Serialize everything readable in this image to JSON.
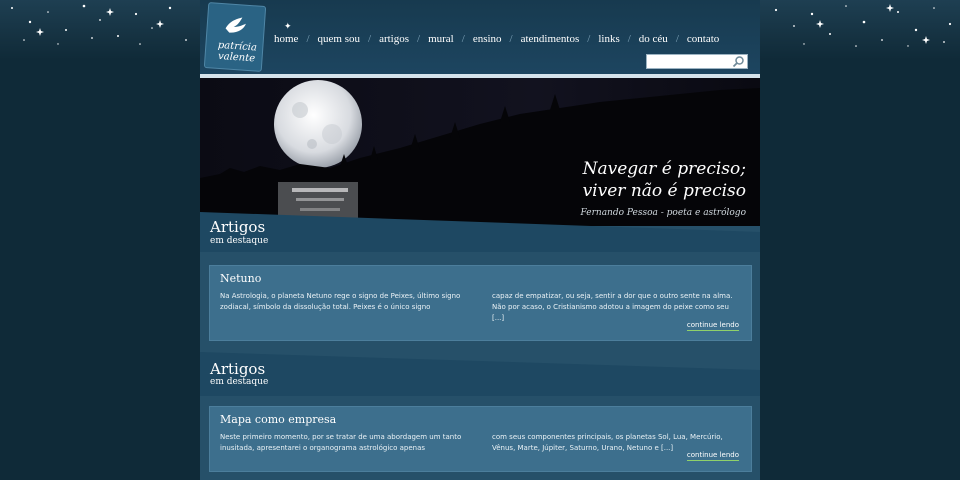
{
  "logo": {
    "line1": "patrícia",
    "line2": "valente"
  },
  "nav": [
    {
      "label": "home"
    },
    {
      "label": "quem sou"
    },
    {
      "label": "artigos"
    },
    {
      "label": "mural"
    },
    {
      "label": "ensino"
    },
    {
      "label": "atendimentos"
    },
    {
      "label": "links"
    },
    {
      "label": "do céu"
    },
    {
      "label": "contato"
    }
  ],
  "search": {
    "value": "",
    "icon": "search-icon"
  },
  "banner": {
    "quote_line1": "Navegar é preciso;",
    "quote_line2": "viver não é preciso",
    "author": "Fernando Pessoa - poeta e astrólogo"
  },
  "sections": [
    {
      "title": "Artigos",
      "subtitle": "em destaque",
      "article": {
        "title": "Netuno",
        "col1": "Na Astrologia, o planeta Netuno rege o signo de Peixes, último signo zodiacal, símbolo da dissolução total. Peixes é o único signo",
        "col2": "capaz de empatizar, ou seja, sentir a dor que o outro sente na alma. Não por acaso, o Cristianismo adotou a imagem do peixe como seu [...]",
        "more": "continue lendo"
      }
    },
    {
      "title": "Artigos",
      "subtitle": "em destaque",
      "article": {
        "title": "Mapa como empresa",
        "col1": "Neste primeiro momento, por se tratar de uma abordagem um tanto inusitada, apresentarei o organograma astrológico apenas",
        "col2": "com seus componentes principais, os planetas Sol, Lua, Mercúrio, Vênus, Marte, Júpiter, Saturno, Urano, Netuno e [...]",
        "more": "continue lendo"
      }
    }
  ],
  "colors": {
    "page": "#265069",
    "card": "#3d6f8d",
    "background": "#0f2a38",
    "link_underline": "#8fd16a"
  }
}
